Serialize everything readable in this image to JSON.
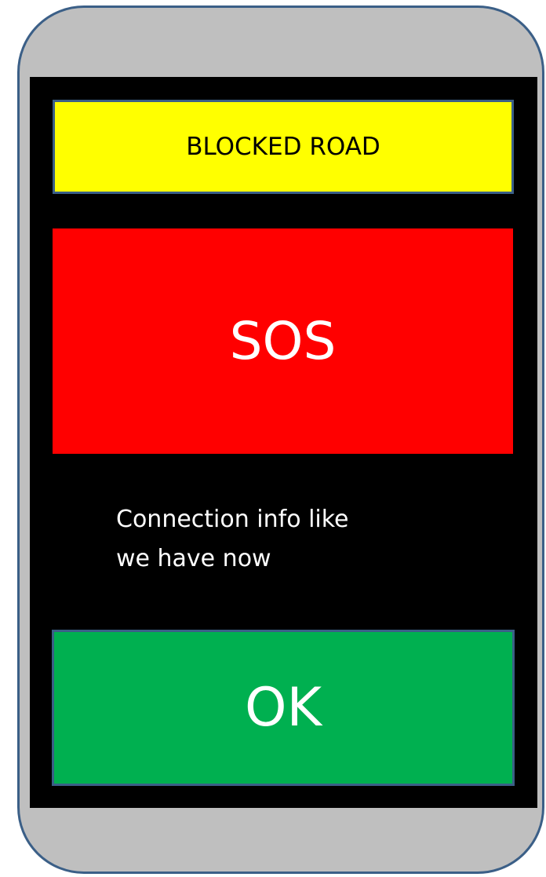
{
  "alert": {
    "title_label": "BLOCKED ROAD"
  },
  "sos_button": {
    "label": "SOS"
  },
  "connection": {
    "info_text": "Connection info like\nwe have now"
  },
  "ok_button": {
    "label": "OK"
  },
  "colors": {
    "frame": "#bfbfbf",
    "frame_border": "#3b5f87",
    "screen": "#000000",
    "blocked_bg": "#ffff00",
    "sos_bg": "#ff0000",
    "ok_bg": "#00b050"
  }
}
